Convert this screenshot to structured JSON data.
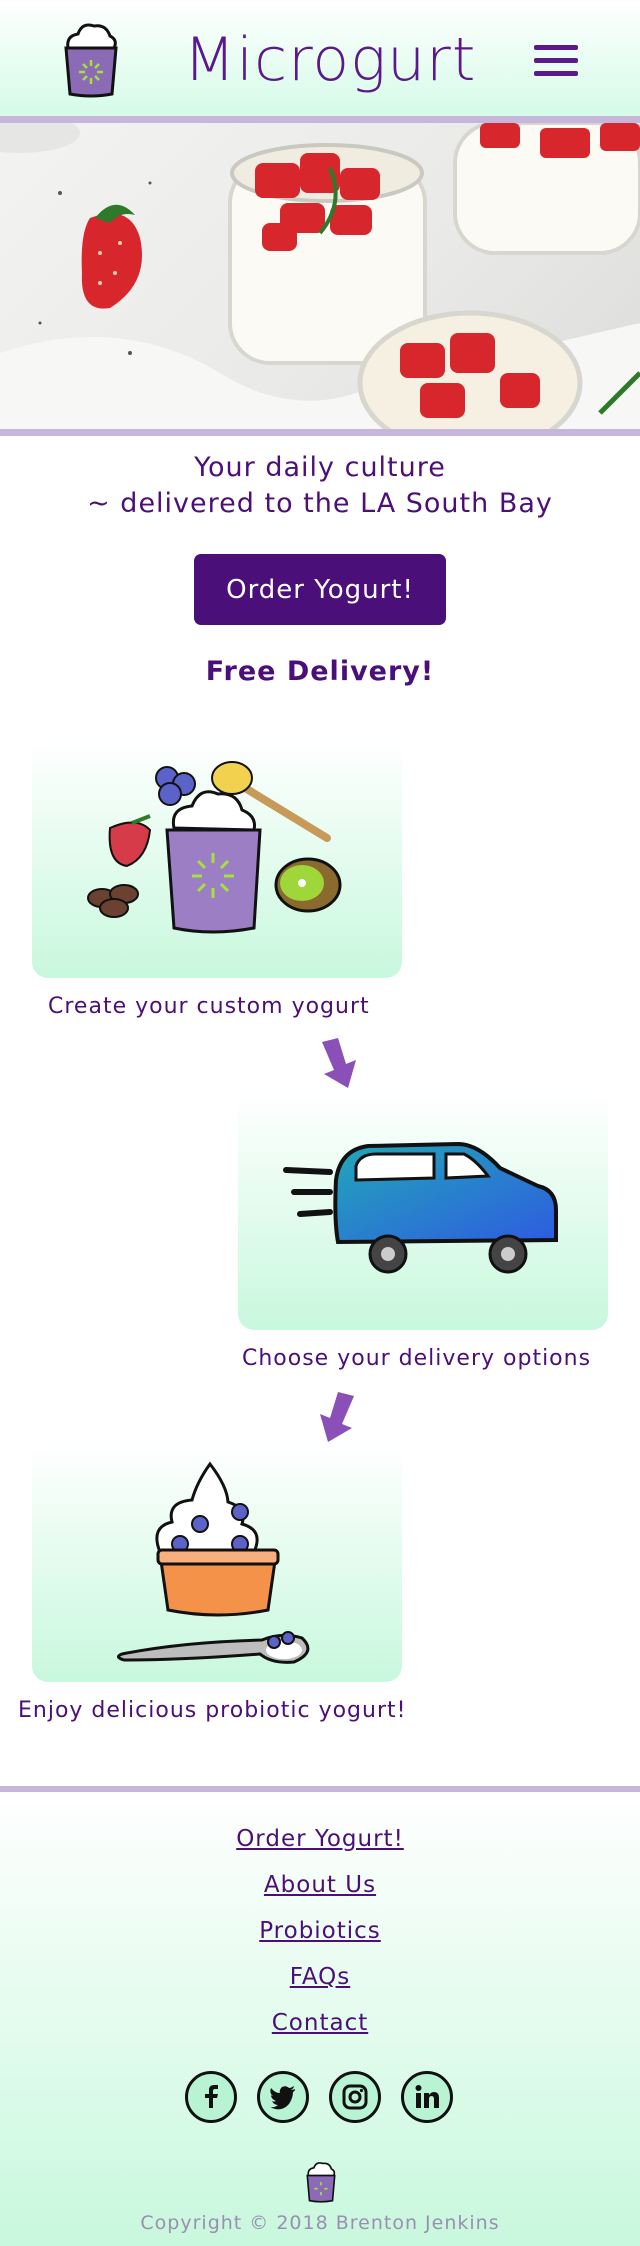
{
  "header": {
    "brand": "Microgurt",
    "menu_icon": "hamburger-icon",
    "logo_icon": "yogurt-cup-logo"
  },
  "hero": {
    "image": "strawberry-yogurt-jars-photo"
  },
  "tagline": {
    "line1": "Your daily culture",
    "line2": "~ delivered to the LA South Bay"
  },
  "cta": {
    "order_label": "Order Yogurt!"
  },
  "promo": {
    "free_delivery": "Free Delivery!"
  },
  "steps": [
    {
      "label": "Create your custom yogurt",
      "icon": "custom-yogurt-illustration"
    },
    {
      "label": "Choose your delivery options",
      "icon": "delivery-car-illustration"
    },
    {
      "label": "Enjoy delicious probiotic yogurt!",
      "icon": "frozen-yogurt-illustration"
    }
  ],
  "footer": {
    "links": [
      "Order Yogurt!",
      "About Us",
      "Probiotics",
      "FAQs",
      "Contact"
    ],
    "social": [
      "facebook-icon",
      "twitter-icon",
      "instagram-icon",
      "linkedin-icon"
    ],
    "copyright": "Copyright © 2018 Brenton Jenkins"
  },
  "colors": {
    "brand_purple": "#4b0f7a",
    "accent_lavender": "#c6b6dc",
    "mint": "#c8f8dd"
  }
}
